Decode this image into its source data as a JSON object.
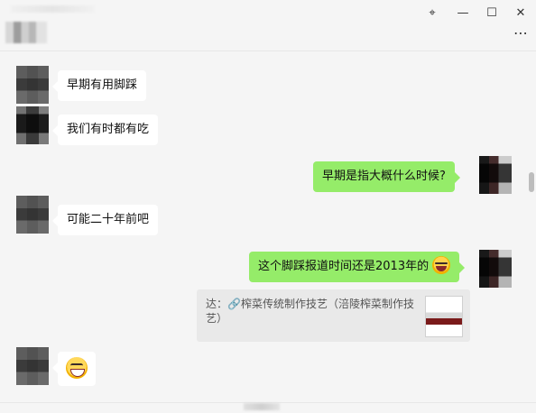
{
  "window": {
    "controls": {
      "pin_icon": "pin-icon",
      "minimize_icon": "minimize-icon",
      "maximize_icon": "maximize-icon",
      "close_icon": "close-icon",
      "more_icon": "more-icon",
      "pin_glyph": "⌖",
      "minimize_glyph": "—",
      "maximize_glyph": "☐",
      "close_glyph": "✕",
      "more_glyph": "⋯"
    }
  },
  "messages": [
    {
      "side": "left",
      "text": "早期有用脚踩"
    },
    {
      "side": "left",
      "text": "我们有时都有吃"
    },
    {
      "side": "right",
      "text": "早期是指大概什么时候?"
    },
    {
      "side": "left",
      "text": "可能二十年前吧"
    },
    {
      "side": "right",
      "text": "这个脚踩报道时间还是2013年的",
      "emoji": "laugh-emoji"
    },
    {
      "side": "left",
      "emoji": "grin-emoji"
    }
  ],
  "quote": {
    "text": "达：🔗榨菜传统制作技艺（涪陵榨菜制作技艺）"
  },
  "colors": {
    "background": "#f5f5f5",
    "bubble_left": "#ffffff",
    "bubble_right": "#95ec69",
    "quote_bg": "#e9e9e9"
  }
}
